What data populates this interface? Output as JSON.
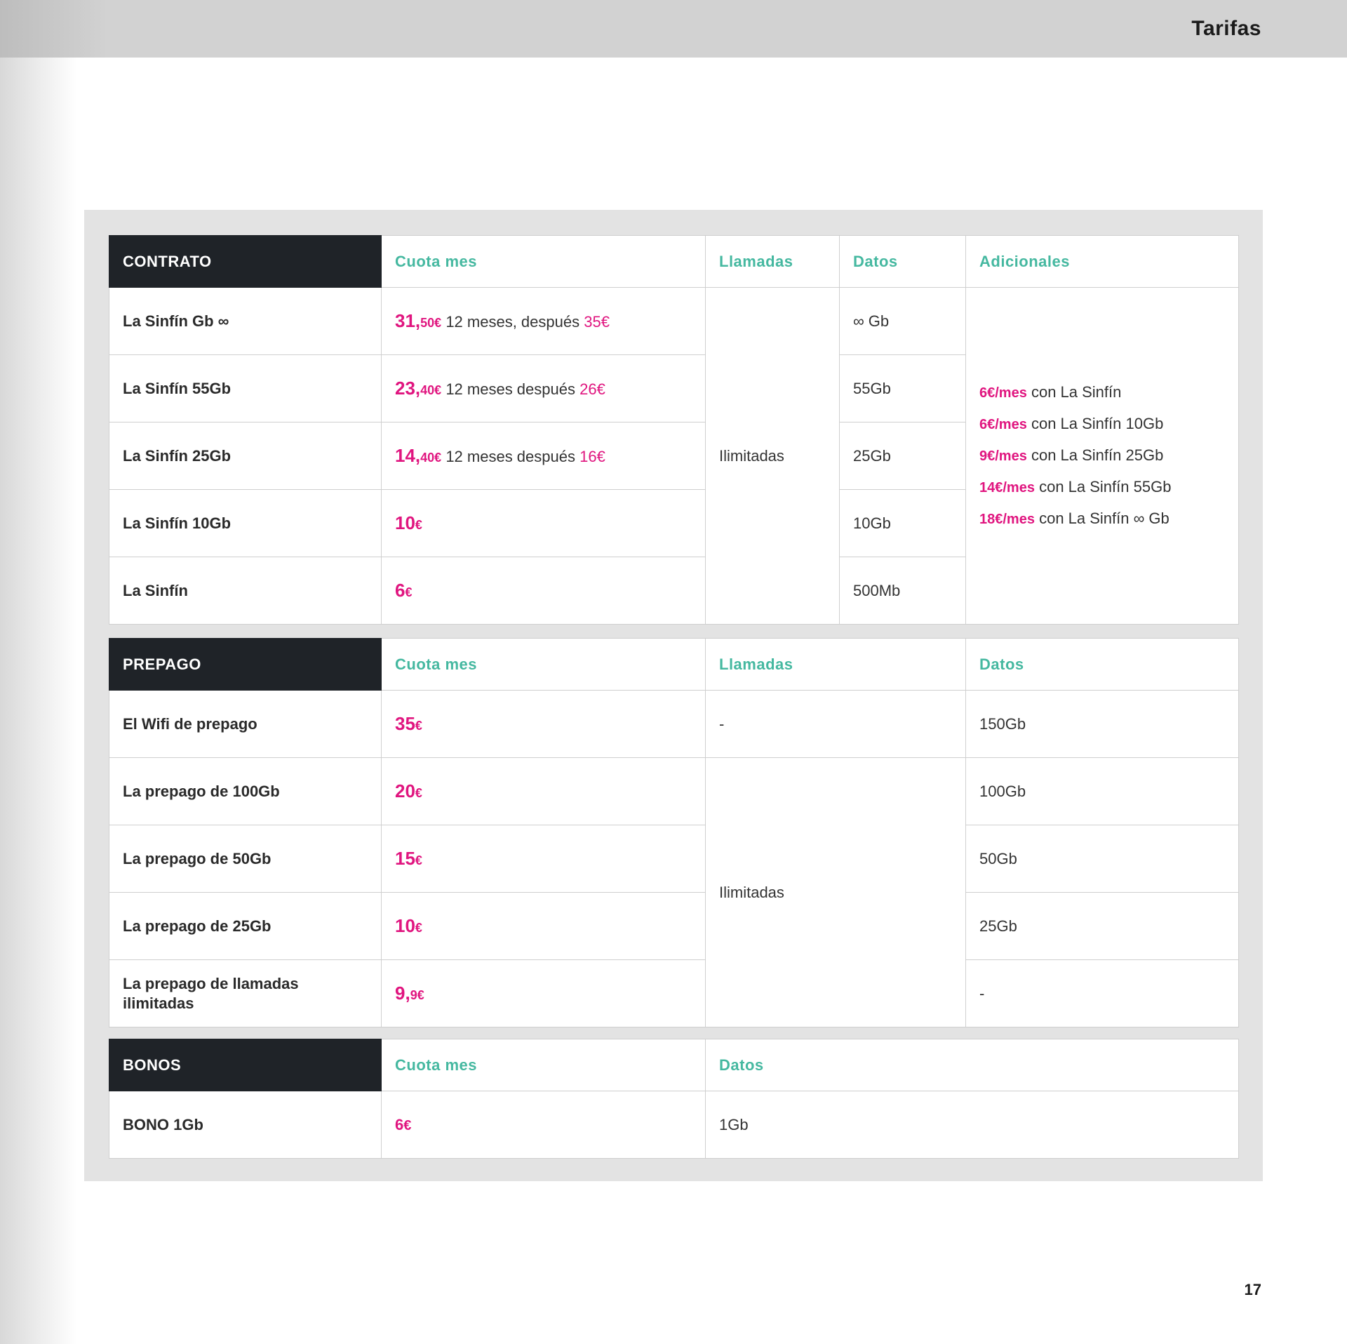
{
  "header": {
    "title": "Tarifas"
  },
  "page_number": "17",
  "contrato": {
    "section": "CONTRATO",
    "columns": {
      "cuota": "Cuota mes",
      "llamadas": "Llamadas",
      "datos": "Datos",
      "adicionales": "Adicionales"
    },
    "llamadas_value": "Ilimitadas",
    "rows": [
      {
        "name": "La Sinfín Gb ∞",
        "price_int": "31,",
        "price_dec": "50€",
        "price_note": " 12 meses, después ",
        "price_after": "35€",
        "datos": "∞ Gb"
      },
      {
        "name": "La Sinfín 55Gb",
        "price_int": "23,",
        "price_dec": "40€",
        "price_note": " 12 meses después ",
        "price_after": "26€",
        "datos": "55Gb"
      },
      {
        "name": "La Sinfín 25Gb",
        "price_int": "14,",
        "price_dec": "40€",
        "price_note": " 12 meses después ",
        "price_after": "16€",
        "datos": "25Gb"
      },
      {
        "name": "La Sinfín 10Gb",
        "price_int": "10",
        "price_dec": "€",
        "datos": "10Gb"
      },
      {
        "name": "La Sinfín",
        "price_int": "6",
        "price_dec": "€",
        "datos": "500Mb"
      }
    ],
    "adicionales": [
      {
        "price": "6€/mes",
        "text": " con La Sinfín"
      },
      {
        "price": "6€/mes",
        "text": " con La Sinfín 10Gb"
      },
      {
        "price": "9€/mes",
        "text": " con La Sinfín 25Gb"
      },
      {
        "price": "14€/mes",
        "text": " con La Sinfín 55Gb"
      },
      {
        "price": "18€/mes",
        "text": " con La Sinfín ∞ Gb"
      }
    ]
  },
  "prepago": {
    "section": "PREPAGO",
    "columns": {
      "cuota": "Cuota mes",
      "llamadas": "Llamadas",
      "datos": "Datos"
    },
    "llamadas_value": "Ilimitadas",
    "rows": [
      {
        "name": "El Wifi de prepago",
        "price_int": "35",
        "price_dec": "€",
        "llamadas": "-",
        "datos": "150Gb"
      },
      {
        "name": "La prepago de 100Gb",
        "price_int": "20",
        "price_dec": "€",
        "datos": "100Gb"
      },
      {
        "name": "La prepago de 50Gb",
        "price_int": "15",
        "price_dec": "€",
        "datos": "50Gb"
      },
      {
        "name": "La prepago de 25Gb",
        "price_int": "10",
        "price_dec": "€",
        "datos": "25Gb"
      },
      {
        "name": "La prepago de llamadas ilimitadas",
        "price_int": "9,",
        "price_dec": "9€",
        "datos": "-"
      }
    ]
  },
  "bonos": {
    "section": "BONOS",
    "columns": {
      "cuota": "Cuota mes",
      "datos": "Datos"
    },
    "rows": [
      {
        "name": "BONO 1Gb",
        "price_int": "6",
        "price_dec": "€",
        "datos": "1Gb"
      }
    ]
  },
  "colors": {
    "accent_pink": "#e0157f",
    "accent_teal": "#45b8a0",
    "section_bg": "#1f2328"
  }
}
